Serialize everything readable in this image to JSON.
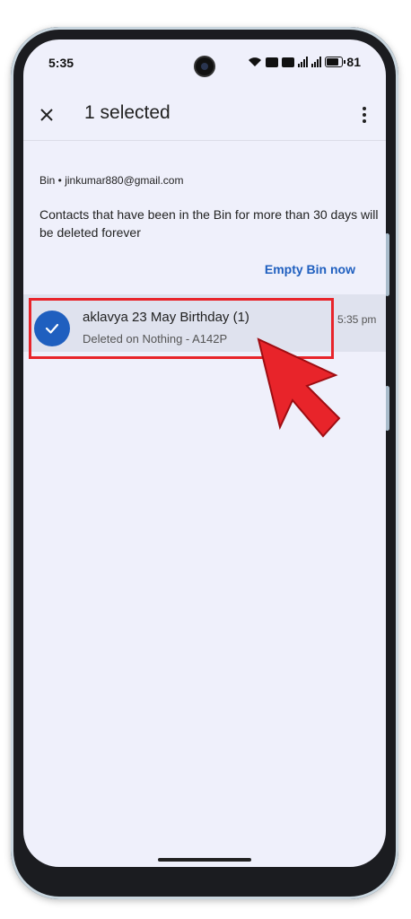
{
  "status_bar": {
    "time": "5:35",
    "battery": "81",
    "icons": [
      "wifi-icon",
      "volte-icon",
      "volte-lte-icon",
      "signal-icon",
      "signal-icon",
      "battery-icon"
    ]
  },
  "app_bar": {
    "close_icon": "close-icon",
    "title": "1 selected",
    "more_icon": "more-vert-icon"
  },
  "bin": {
    "account": "Bin • jinkumar880@gmail.com",
    "notice": "Contacts that have been in the Bin for more than 30 days will be deleted forever",
    "empty_bin_label": "Empty Bin now"
  },
  "contacts": [
    {
      "name": "aklavya 23 May Birthday (1)",
      "subtitle": "Deleted on Nothing - A142P",
      "time": "5:35 pm",
      "selected": true
    }
  ],
  "colors": {
    "accent": "#1f5fbf",
    "highlight": "#e8242a",
    "screen_bg": "#eff0fb"
  }
}
